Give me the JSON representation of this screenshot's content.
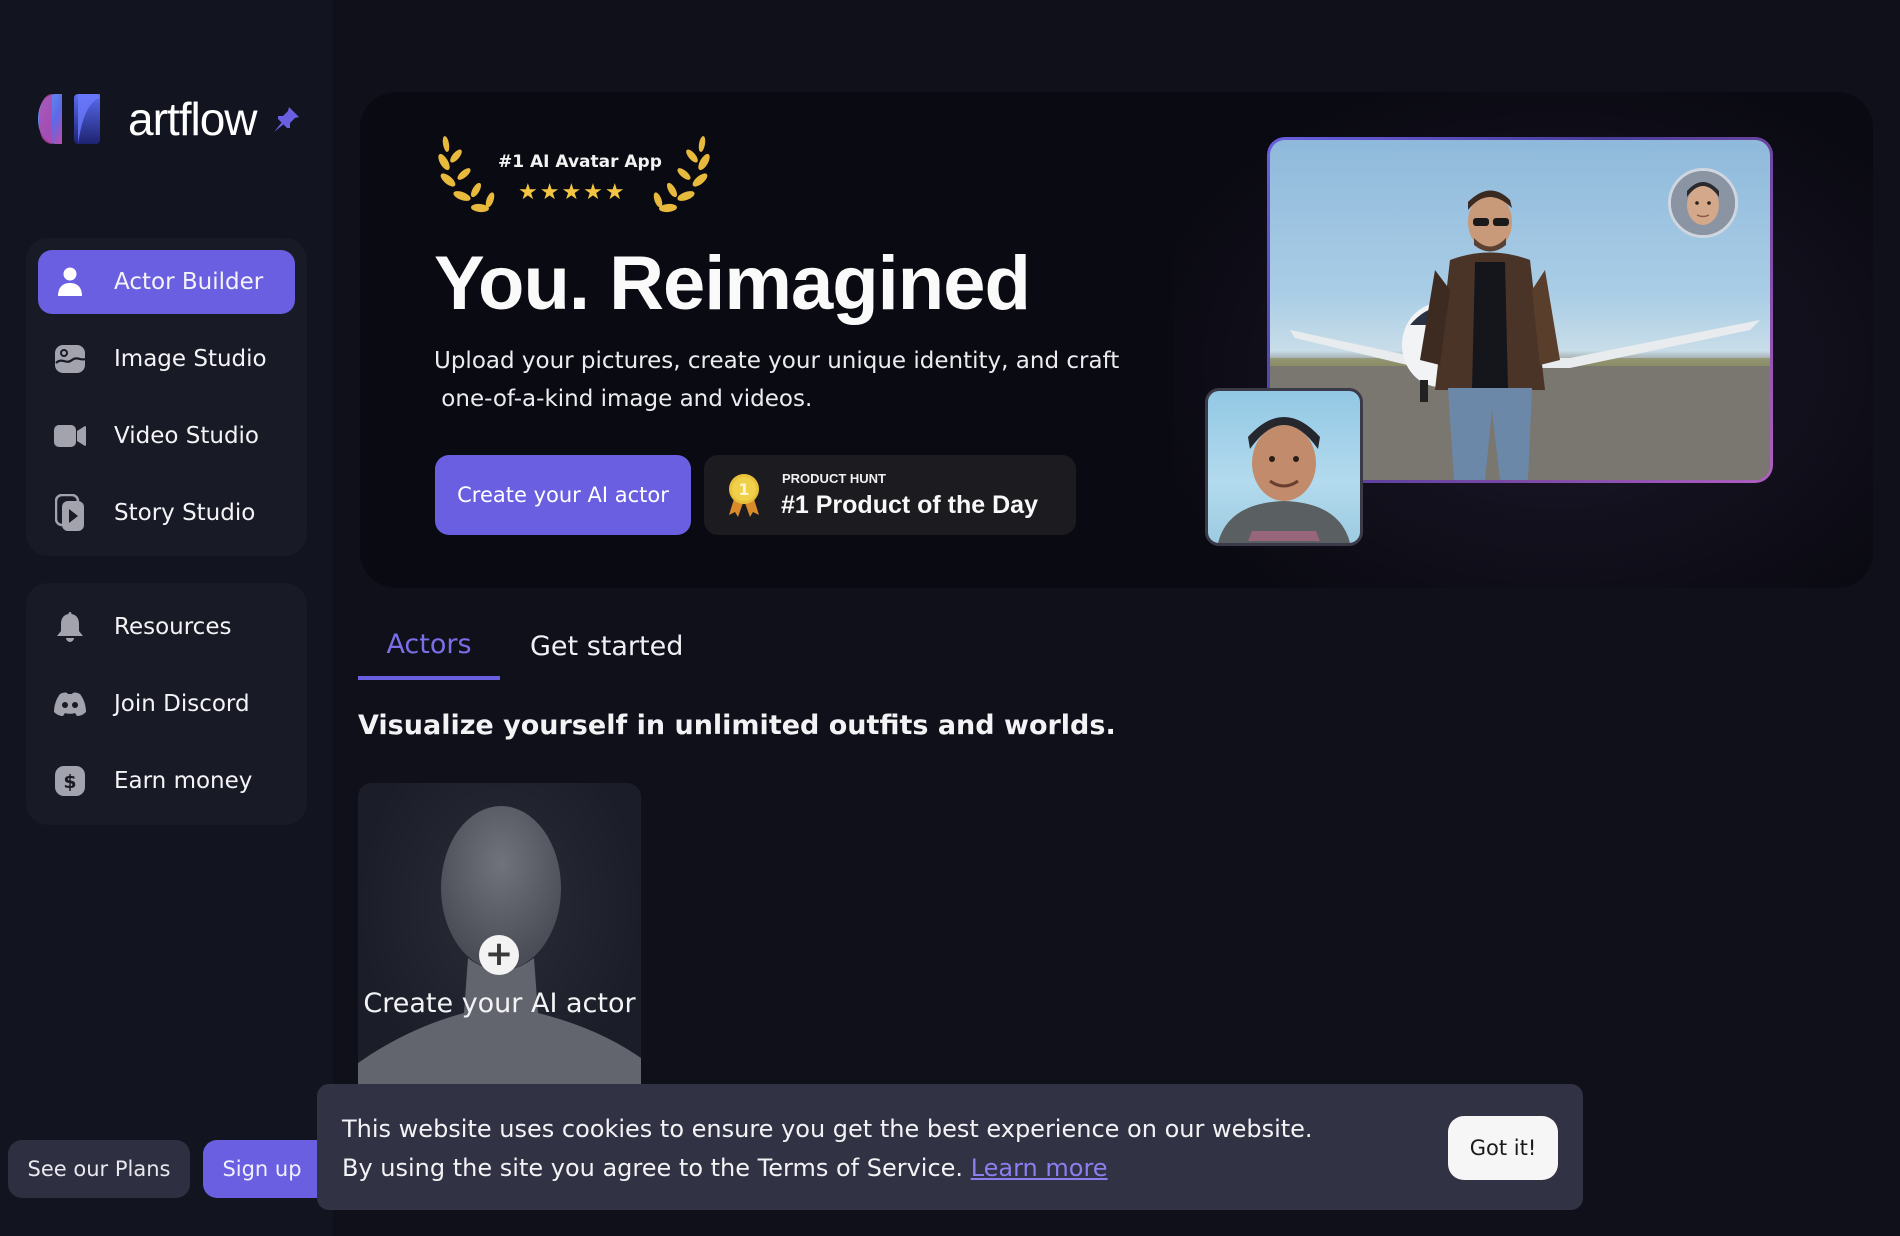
{
  "brand": {
    "name_light": "art",
    "name_bold": "flow",
    "accent": "#6a5fe0"
  },
  "sidebar": {
    "primary": [
      {
        "label": "Actor Builder",
        "icon": "user-icon",
        "active": true
      },
      {
        "label": "Image Studio",
        "icon": "image-icon",
        "active": false
      },
      {
        "label": "Video Studio",
        "icon": "video-camera-icon",
        "active": false
      },
      {
        "label": "Story Studio",
        "icon": "story-play-icon",
        "active": false
      }
    ],
    "secondary": [
      {
        "label": "Resources",
        "icon": "bell-icon"
      },
      {
        "label": "Join Discord",
        "icon": "discord-icon"
      },
      {
        "label": "Earn money",
        "icon": "dollar-icon"
      }
    ],
    "plans_label": "See our Plans",
    "signup_label": "Sign up"
  },
  "hero": {
    "award_text": "#1 AI Avatar App",
    "award_stars": "★★★★★",
    "rating": 5,
    "title": "You. Reimagined",
    "subtitle_line1": "Upload your pictures, create your unique identity, and craft",
    "subtitle_line2": " one-of-a-kind image and videos.",
    "cta_label": "Create your AI actor",
    "product_hunt": {
      "kicker": "PRODUCT HUNT",
      "title": "#1 Product of the Day",
      "medal_number": "1"
    }
  },
  "tabs": [
    {
      "label": "Actors",
      "active": true
    },
    {
      "label": "Get started",
      "active": false
    }
  ],
  "section_title": "Visualize yourself in unlimited outfits and worlds.",
  "actor_card": {
    "label": "Create your AI actor"
  },
  "cookie": {
    "text": "This website uses cookies to ensure you get the best experience on our website. By using the site you agree to the Terms of Service. ",
    "link_label": "Learn more",
    "button_label": "Got it!"
  }
}
